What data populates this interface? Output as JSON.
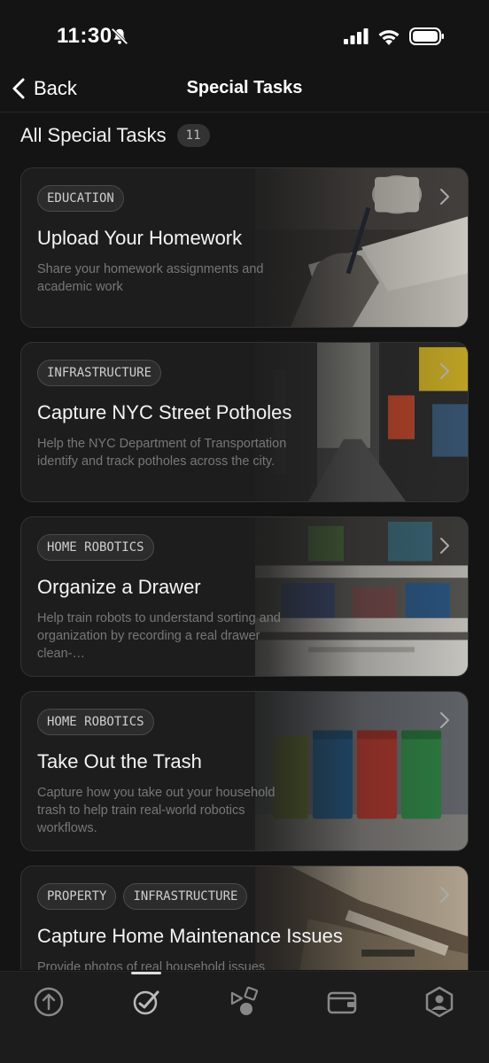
{
  "status_bar": {
    "time": "11:30",
    "icons": [
      "bell-slash-icon",
      "cellular-icon",
      "wifi-icon",
      "battery-icon"
    ]
  },
  "nav": {
    "back_label": "Back",
    "title": "Special Tasks"
  },
  "section": {
    "title": "All Special Tasks",
    "count": "11"
  },
  "tasks": [
    {
      "tags": [
        "EDUCATION"
      ],
      "title": "Upload Your Homework",
      "description": "Share your homework assignments and academic work",
      "image": "homework-desk-photo"
    },
    {
      "tags": [
        "INFRASTRUCTURE"
      ],
      "title": "Capture NYC Street Potholes",
      "description": "Help the NYC Department of Transportation identify and track potholes across the city.",
      "image": "nyc-street-photo"
    },
    {
      "tags": [
        "HOME ROBOTICS"
      ],
      "title": "Organize a Drawer",
      "description": "Help train robots to understand sorting and organization by recording a real drawer clean-…",
      "image": "drawer-photo"
    },
    {
      "tags": [
        "HOME ROBOTICS"
      ],
      "title": "Take Out the Trash",
      "description": "Capture how you take out your household trash to help train real-world robotics workflows.",
      "image": "trash-bins-photo"
    },
    {
      "tags": [
        "PROPERTY",
        "INFRASTRUCTURE"
      ],
      "title": "Capture Home Maintenance Issues",
      "description": "Provide photos of real household issues (leaks,",
      "image": "home-repair-photo"
    }
  ],
  "tab_bar": {
    "items": [
      "upload-icon",
      "tasks-icon",
      "shapes-icon",
      "wallet-icon",
      "profile-icon"
    ],
    "active": 1
  },
  "colors": {
    "background": "#141414",
    "card": "#1d1d1d",
    "muted_text": "#777777"
  }
}
